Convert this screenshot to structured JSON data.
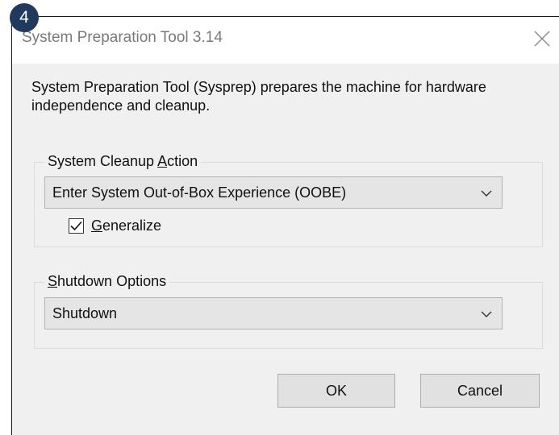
{
  "badge": "4",
  "window": {
    "title": "System Preparation Tool 3.14",
    "close_icon": "close-icon"
  },
  "description": "System Preparation Tool (Sysprep) prepares the machine for hardware independence and cleanup.",
  "cleanup_group": {
    "label_before": "System Cleanup ",
    "label_accel": "A",
    "label_after": "ction",
    "action_value": "Enter System Out-of-Box Experience (OOBE)",
    "generalize_accel": "G",
    "generalize_rest": "eneralize",
    "generalize_checked": true
  },
  "shutdown_group": {
    "label_accel": "S",
    "label_rest": "hutdown Options",
    "value": "Shutdown"
  },
  "buttons": {
    "ok": "OK",
    "cancel": "Cancel"
  }
}
